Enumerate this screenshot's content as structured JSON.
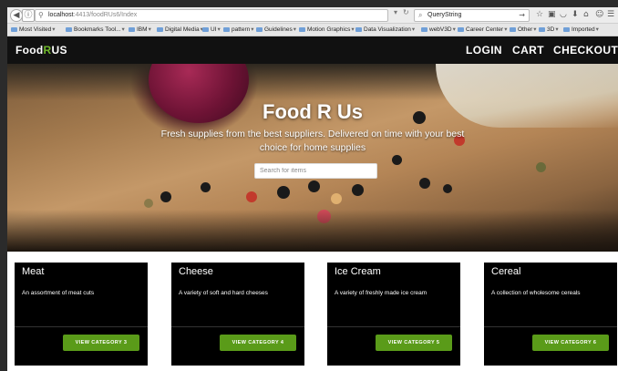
{
  "browser": {
    "url_host": "localhost",
    "url_path": ":4413/foodRUs6/Index",
    "search_text": "QueryString",
    "bookmarks": [
      "Most Visited",
      "Bookmarks Tool...",
      "IBM",
      "Digital Media",
      "UI",
      "pattern",
      "Guidelines",
      "Motion Graphics",
      "Data Visualization",
      "webV3D",
      "Career Center",
      "Other",
      "3D",
      "Imported"
    ]
  },
  "site": {
    "brand_prefix": "Food",
    "brand_r": "R",
    "brand_suffix": "US",
    "nav": {
      "login": "LOGIN",
      "cart": "CART",
      "checkout": "CHECKOUT"
    }
  },
  "hero": {
    "title": "Food R Us",
    "subtitle": "Fresh supplies from the best suppliers. Delivered on time with your best choice for home supplies",
    "search_placeholder": "Search for items"
  },
  "categories": [
    {
      "title": "Meat",
      "description": "An assortment of meat cuts",
      "button": "VIEW CATEGORY 3"
    },
    {
      "title": "Cheese",
      "description": "A variety of soft and hard cheeses",
      "button": "VIEW CATEGORY 4"
    },
    {
      "title": "Ice Cream",
      "description": "A variety of freshly made ice cream",
      "button": "VIEW CATEGORY 5"
    },
    {
      "title": "Cereal",
      "description": "A collection of wholesome cereals",
      "button": "VIEW CATEGORY 6"
    }
  ],
  "colors": {
    "accent_green": "#5a9b19",
    "brand_r": "#6fb82b",
    "nav_bg": "#111111"
  }
}
